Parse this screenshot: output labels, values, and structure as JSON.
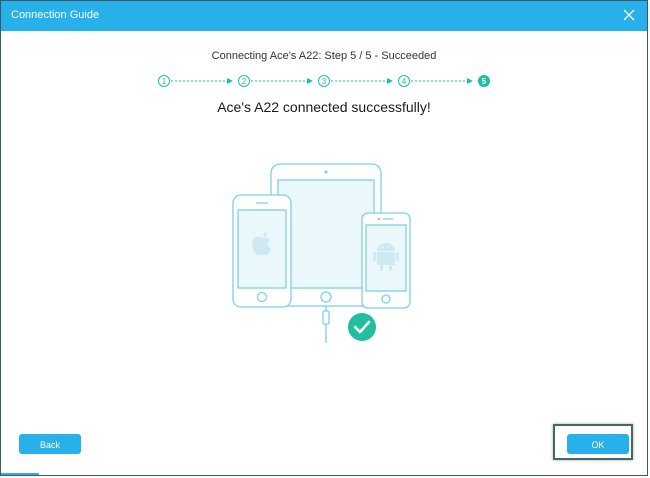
{
  "dialog": {
    "title": "Connection Guide",
    "close_icon": "close-icon"
  },
  "status_text": "Connecting Ace's A22: Step 5 / 5 - Succeeded",
  "steps": {
    "labels": [
      "1",
      "2",
      "3",
      "4",
      "5"
    ],
    "current": 5,
    "accent_color": "#1fbfa0"
  },
  "headline": "Ace's A22 connected successfully!",
  "illustration": {
    "icons": [
      "tablet-icon",
      "iphone-icon",
      "android-phone-icon",
      "usb-cable-icon",
      "check-circle-icon"
    ],
    "line_color": "#7dd0e6",
    "check_color": "#1fbfa0"
  },
  "buttons": {
    "back_label": "Back",
    "ok_label": "OK"
  },
  "colors": {
    "titlebar": "#27b0e9",
    "button": "#27b0e9"
  }
}
